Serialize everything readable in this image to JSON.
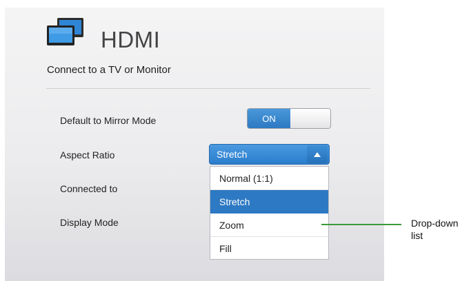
{
  "header": {
    "title": "HDMI",
    "subtitle": "Connect to a TV or Monitor",
    "icon": "dual-monitor-icon"
  },
  "settings": {
    "mirror_label": "Default to Mirror Mode",
    "mirror_toggle": "ON",
    "aspect_label": "Aspect Ratio",
    "aspect_value": "Stretch",
    "connected_label": "Connected to",
    "display_mode_label": "Display Mode"
  },
  "dropdown": {
    "options": [
      "Normal (1:1)",
      "Stretch",
      "Zoom",
      "Fill"
    ],
    "selected": "Stretch"
  },
  "callout": {
    "line1": "Drop-down",
    "line2": "list"
  },
  "colors": {
    "accent": "#2e79c3",
    "callout_line": "#3a9a3a"
  }
}
